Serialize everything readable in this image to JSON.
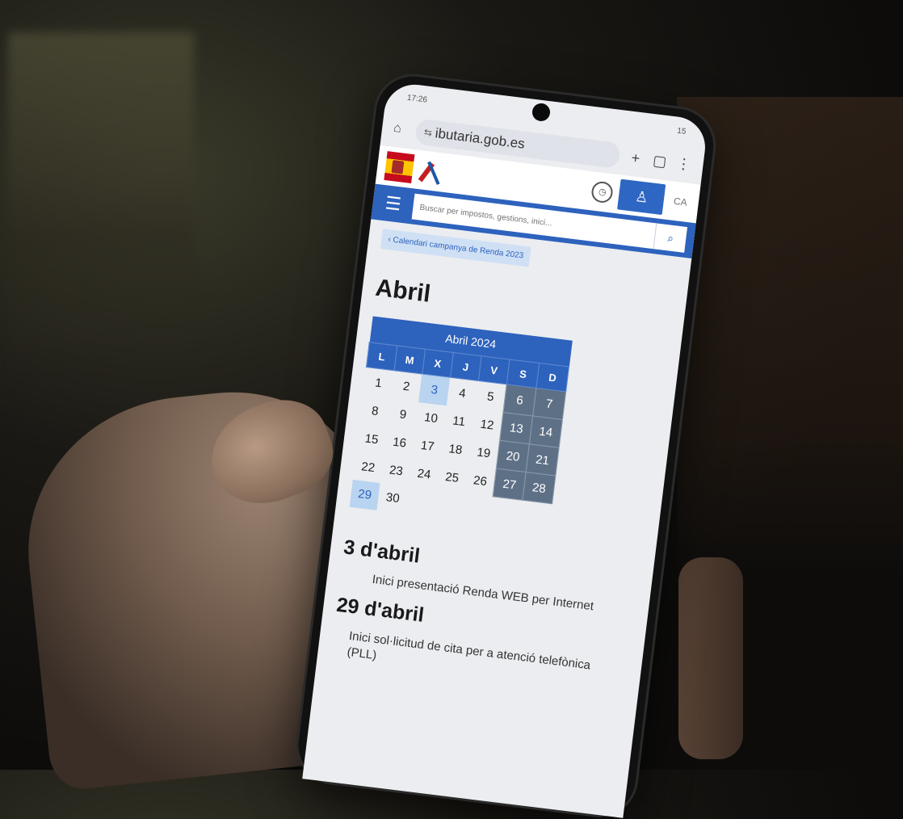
{
  "statusbar": {
    "time": "17:26",
    "battery": "15"
  },
  "browser": {
    "url": "ibutaria.gob.es"
  },
  "site": {
    "language": "CA",
    "search_placeholder": "Buscar per impostos, gestions, inici..."
  },
  "breadcrumb": "Calendari campanya de Renda 2023",
  "page_title": "Abril",
  "calendar": {
    "title": "Abril 2024",
    "weekdays": [
      "L",
      "M",
      "X",
      "J",
      "V",
      "S",
      "D"
    ],
    "weeks": [
      [
        "1",
        "2",
        "3",
        "4",
        "5",
        "6",
        "7"
      ],
      [
        "8",
        "9",
        "10",
        "11",
        "12",
        "13",
        "14"
      ],
      [
        "15",
        "16",
        "17",
        "18",
        "19",
        "20",
        "21"
      ],
      [
        "22",
        "23",
        "24",
        "25",
        "26",
        "27",
        "28"
      ],
      [
        "29",
        "30",
        "",
        "",
        "",
        "",
        ""
      ]
    ],
    "highlighted": [
      "3",
      "29"
    ]
  },
  "events": [
    {
      "date": "3 d'abril",
      "description": "Inici presentació Renda WEB per Internet"
    },
    {
      "date": "29 d'abril",
      "description": "Inici sol·licitud de cita per a atenció telefònica (PLL)"
    }
  ]
}
